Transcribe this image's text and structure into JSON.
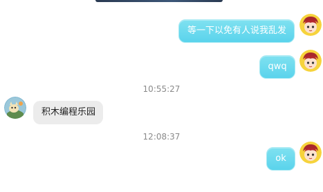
{
  "messages": [
    {
      "side": "out",
      "text": "等一下以免有人说我乱发"
    },
    {
      "side": "out",
      "text": "qwq"
    },
    {
      "side": "in",
      "text": "积木编程乐园"
    },
    {
      "side": "out",
      "text": "ok"
    }
  ],
  "timestamps": [
    "10:55:27",
    "12:08:37"
  ],
  "colors": {
    "outgoing_bubble": "#5ad3ec",
    "incoming_bubble": "#ececec",
    "timestamp": "#8a8a8a"
  },
  "icons": {
    "self_avatar": "anime-character-avatar-icon",
    "other_avatar": "cartoon-creature-avatar-icon"
  }
}
